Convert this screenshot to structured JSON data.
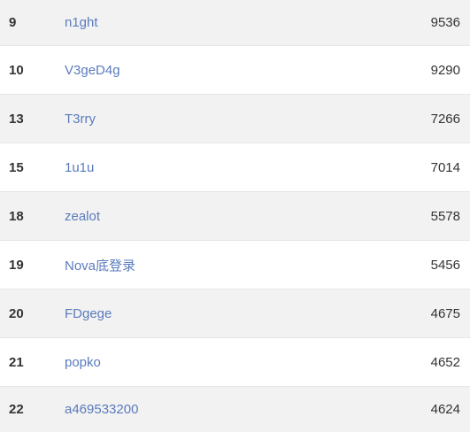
{
  "leaderboard": {
    "rows": [
      {
        "rank": "9",
        "name": "n1ght",
        "score": "9536"
      },
      {
        "rank": "10",
        "name": "V3geD4g",
        "score": "9290"
      },
      {
        "rank": "13",
        "name": "T3rry",
        "score": "7266"
      },
      {
        "rank": "15",
        "name": "1u1u",
        "score": "7014"
      },
      {
        "rank": "18",
        "name": "zealot",
        "score": "5578"
      },
      {
        "rank": "19",
        "name": "Nova底登录",
        "score": "5456"
      },
      {
        "rank": "20",
        "name": "FDgege",
        "score": "4675"
      },
      {
        "rank": "21",
        "name": "popko",
        "score": "4652"
      },
      {
        "rank": "22",
        "name": "a469533200",
        "score": "4624"
      }
    ]
  },
  "colors": {
    "row_alt_bg": "#f2f2f2",
    "link": "#5a7bbd",
    "text": "#333333"
  }
}
